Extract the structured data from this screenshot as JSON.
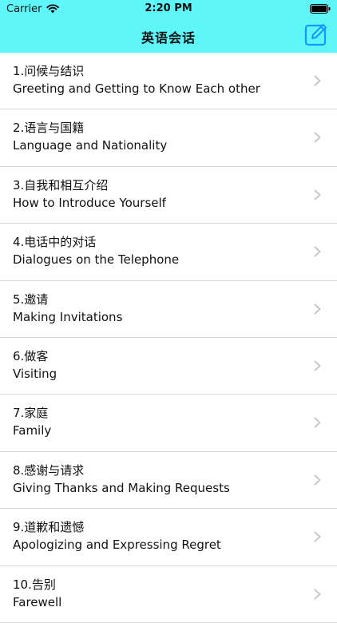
{
  "status_bar": {
    "carrier": "Carrier",
    "time": "2:20 PM",
    "battery_level": 1.0
  },
  "nav": {
    "title": "英语会话",
    "edit_icon": "edit-icon"
  },
  "colors": {
    "header_bg": "#5ff6fa",
    "accent": "#1199ff",
    "separator": "#d9d9dc",
    "chevron": "#c7c7cc"
  },
  "items": [
    {
      "zh": "1.问候与结识",
      "en": "Greeting and Getting to Know Each other"
    },
    {
      "zh": "2.语言与国籍",
      "en": "Language and Nationality"
    },
    {
      "zh": "3.自我和相互介绍",
      "en": "How to Introduce Yourself"
    },
    {
      "zh": "4.电话中的对话",
      "en": "Dialogues on the Telephone"
    },
    {
      "zh": "5.邀请",
      "en": "Making Invitations"
    },
    {
      "zh": "6.做客",
      "en": "Visiting"
    },
    {
      "zh": "7.家庭",
      "en": "Family"
    },
    {
      "zh": "8.感谢与请求",
      "en": "Giving Thanks and Making Requests"
    },
    {
      "zh": "9.道歉和遗憾",
      "en": "Apologizing and Expressing Regret"
    },
    {
      "zh": "10.告别",
      "en": "Farewell"
    }
  ]
}
